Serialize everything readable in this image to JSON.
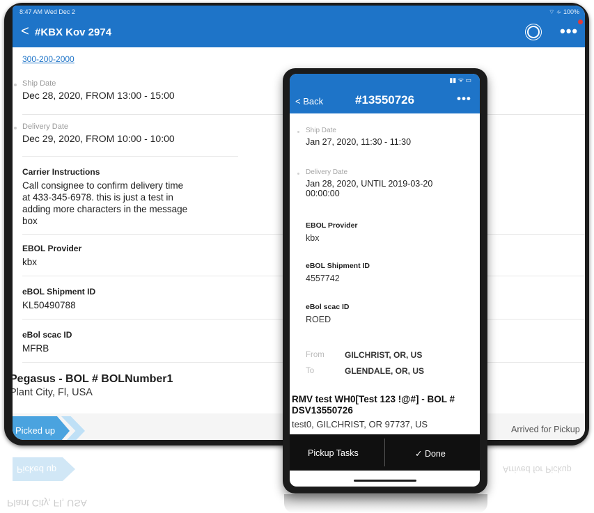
{
  "tablet": {
    "status_time": "8:47 AM  Wed Dec 2",
    "status_right": "⌔ ∻ 100%",
    "nav": {
      "back": "<",
      "title": "#KBX Kov 2974",
      "more": "•••"
    },
    "phone_link": "300-200-2000",
    "ship_date": {
      "label": "Ship Date",
      "value": "Dec 28, 2020, FROM 13:00 - 15:00"
    },
    "delivery_date": {
      "label": "Delivery Date",
      "value": "Dec 29, 2020, FROM 10:00 - 10:00"
    },
    "carrier": {
      "label": "Carrier Instructions",
      "value": "Call consignee to confirm delivery time at 433-345-6978. this is just a test in adding more characters in the message box"
    },
    "ebol_provider": {
      "label": "EBOL Provider",
      "value": "kbx"
    },
    "ebol_shipment": {
      "label": "eBOL Shipment ID",
      "value": "KL50490788"
    },
    "ebol_scac": {
      "label": "eBol scac ID",
      "value": "MFRB"
    },
    "pegasus_title": "Pegasus - BOL # BOLNumber1",
    "pegasus_location": "Plant City, Fl, USA",
    "status_picked": "Picked up",
    "status_arrived": "Arrived for Pickup"
  },
  "reflection": {
    "picked": "Picked up",
    "arrived": "Arrived for Pickup",
    "plant": "Plant City, Fl, USA"
  },
  "phone": {
    "status_icons": "▮▮ ᯤ ▭",
    "back": "< Back",
    "title": "#13550726",
    "more": "•••",
    "ship_date": {
      "label": "Ship Date",
      "value": "Jan 27, 2020,  11:30 - 11:30"
    },
    "delivery_date": {
      "label": "Delivery Date",
      "value": "Jan 28, 2020, UNTIL 2019-03-20 00:00:00"
    },
    "ebol_provider": {
      "label": "EBOL Provider",
      "value": "kbx"
    },
    "ebol_shipment": {
      "label": "eBOL Shipment ID",
      "value": "4557742"
    },
    "ebol_scac": {
      "label": "eBol scac ID",
      "value": "ROED"
    },
    "route": {
      "from_label": "From",
      "from": "GILCHRIST, OR, US",
      "to_label": "To",
      "to": "GLENDALE, OR, US"
    },
    "rmv_title": "RMV test WH0[Test 123 !@#] - BOL # DSV13550726",
    "rmv_address": "test0, GILCHRIST, OR 97737, US",
    "pickup_tasks": "Pickup Tasks",
    "done": "✓ Done"
  },
  "colors": {
    "brand_blue": "#1e74c8",
    "progress_blue": "#4aa3df",
    "notification": "#e23a3a"
  },
  "icons": {
    "support": "headset-icon",
    "back": "chevron-left-icon",
    "more": "ellipsis-icon",
    "done": "checkmark-icon"
  }
}
